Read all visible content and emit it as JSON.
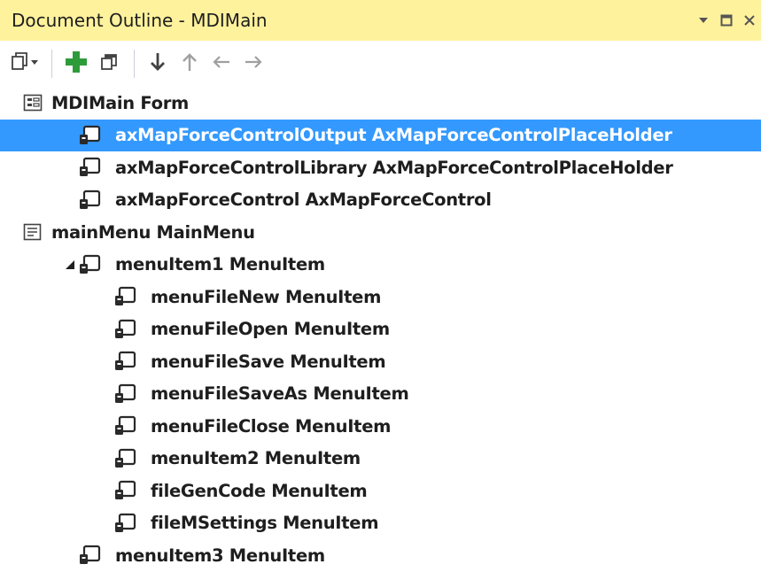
{
  "window": {
    "title": "Document Outline - MDIMain",
    "dropdown_icon": "dropdown-arrow-icon",
    "maximize_icon": "maximize-icon",
    "close_icon": "close-icon"
  },
  "toolbar": {
    "buttons": [
      {
        "name": "view-options",
        "icon": "view-options-icon"
      },
      {
        "name": "add",
        "icon": "add-icon"
      },
      {
        "name": "copy",
        "icon": "copy-icon"
      },
      {
        "name": "move-down",
        "icon": "move-down-icon"
      },
      {
        "name": "move-up",
        "icon": "move-up-icon"
      },
      {
        "name": "move-out",
        "icon": "move-left-icon"
      },
      {
        "name": "move-in",
        "icon": "move-right-icon"
      }
    ]
  },
  "colors": {
    "title_bar": "#fff29d",
    "selection": "#3399ff",
    "add_green": "#2e9b3a"
  },
  "tree": [
    {
      "label": "MDIMain  Form",
      "level": 0,
      "expanded": true,
      "icon": "form-icon"
    },
    {
      "label": "axMapForceControlOutput  AxMapForceControlPlaceHolder",
      "level": 1,
      "selected": true,
      "icon": "control-icon"
    },
    {
      "label": "axMapForceControlLibrary  AxMapForceControlPlaceHolder",
      "level": 1,
      "icon": "control-icon"
    },
    {
      "label": "axMapForceControl  AxMapForceControl",
      "level": 1,
      "icon": "control-icon"
    },
    {
      "label": "mainMenu  MainMenu",
      "level": 0,
      "expanded": true,
      "icon": "menu-icon"
    },
    {
      "label": "menuItem1  MenuItem",
      "level": 1,
      "expanded": true,
      "icon": "control-icon"
    },
    {
      "label": "menuFileNew  MenuItem",
      "level": 2,
      "icon": "control-icon"
    },
    {
      "label": "menuFileOpen  MenuItem",
      "level": 2,
      "icon": "control-icon"
    },
    {
      "label": "menuFileSave  MenuItem",
      "level": 2,
      "icon": "control-icon"
    },
    {
      "label": "menuFileSaveAs  MenuItem",
      "level": 2,
      "icon": "control-icon"
    },
    {
      "label": "menuFileClose  MenuItem",
      "level": 2,
      "icon": "control-icon"
    },
    {
      "label": "menuItem2  MenuItem",
      "level": 2,
      "icon": "control-icon"
    },
    {
      "label": "fileGenCode  MenuItem",
      "level": 2,
      "icon": "control-icon"
    },
    {
      "label": "fileMSettings  MenuItem",
      "level": 2,
      "icon": "control-icon"
    },
    {
      "label": "menuItem3  MenuItem",
      "level": 1,
      "icon": "control-icon"
    }
  ]
}
